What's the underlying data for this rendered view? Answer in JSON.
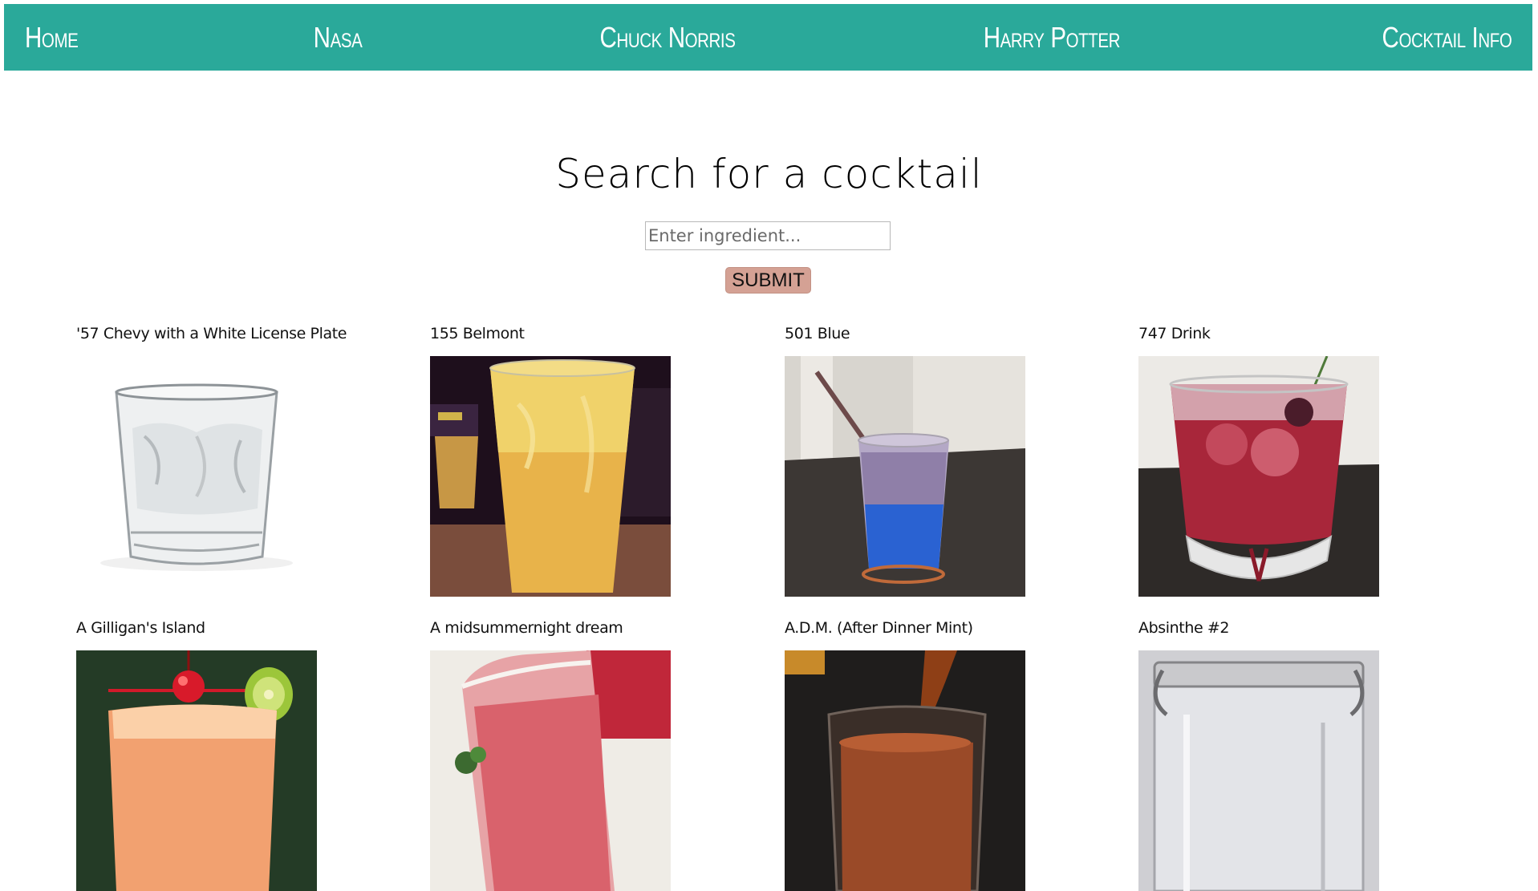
{
  "nav": {
    "items": [
      "Home",
      "Nasa",
      "Chuck Norris",
      "Harry Potter",
      "Cocktail Info"
    ],
    "bg_color": "#2aa99a"
  },
  "page": {
    "title": "Search for a cocktail",
    "search_placeholder": "Enter ingredient...",
    "submit_label": "SUBMIT",
    "submit_color": "#d4a194"
  },
  "cocktails": [
    {
      "name": "'57 Chevy with a White License Plate",
      "image": "clear-glass-with-ice"
    },
    {
      "name": "155 Belmont",
      "image": "tall-yellow-drink"
    },
    {
      "name": "501 Blue",
      "image": "blue-layered-drink-with-straw"
    },
    {
      "name": "747 Drink",
      "image": "red-drink-with-ice"
    },
    {
      "name": "A Gilligan's Island",
      "image": "orange-drink-with-cherry-and-kiwi"
    },
    {
      "name": "A midsummernight dream",
      "image": "pink-frothy-drink"
    },
    {
      "name": "A.D.M. (After Dinner Mint)",
      "image": "brown-drink-being-poured"
    },
    {
      "name": "Absinthe #2",
      "image": "glass-jar"
    }
  ]
}
